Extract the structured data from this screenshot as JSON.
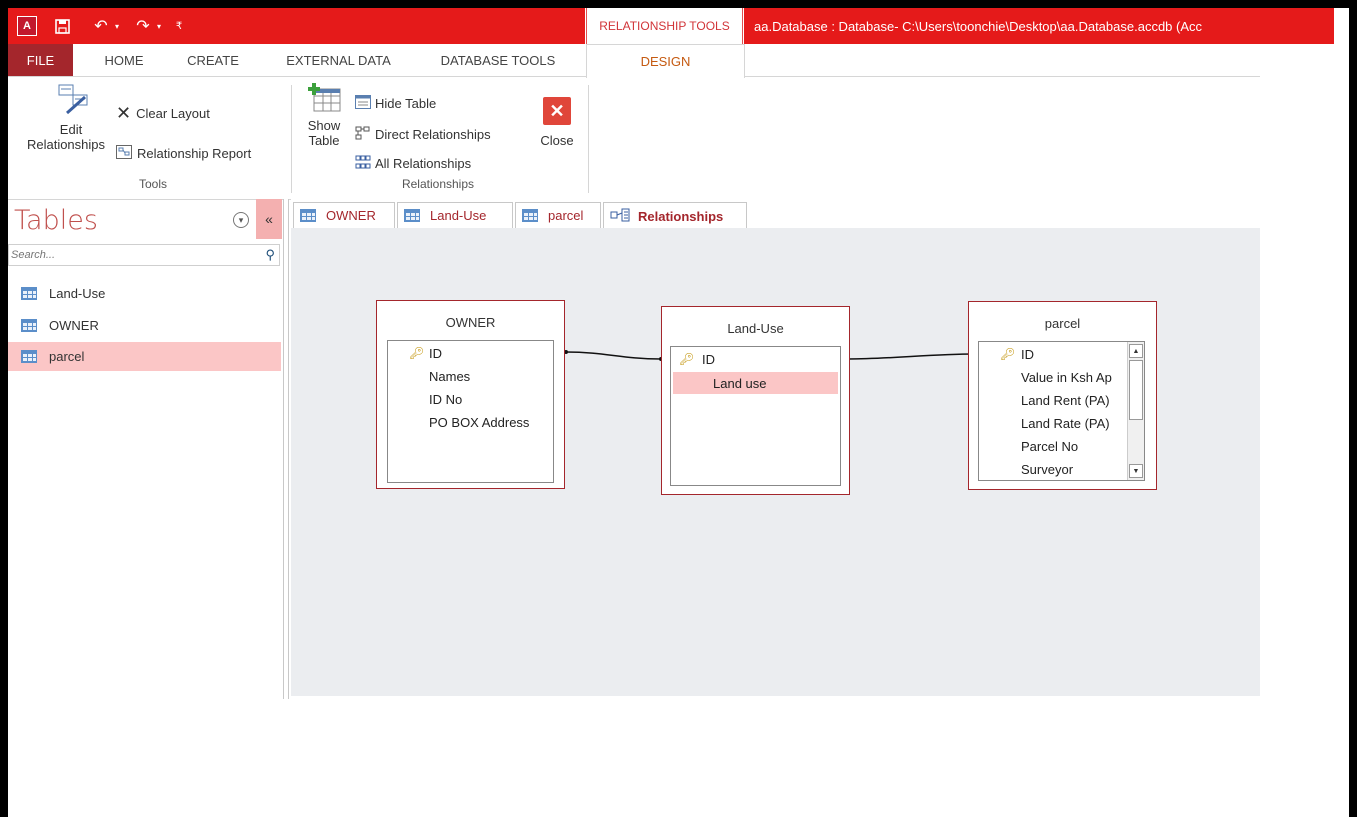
{
  "window": {
    "title": "aa.Database : Database- C:\\Users\\toonchie\\Desktop\\aa.Database.accdb (Acc",
    "context_label": "RELATIONSHIP TOOLS"
  },
  "ribbon_tabs": [
    "FILE",
    "HOME",
    "CREATE",
    "EXTERNAL DATA",
    "DATABASE TOOLS",
    "DESIGN"
  ],
  "ribbon": {
    "tools": {
      "edit_relationships": "Edit Relationships",
      "edit_line1": "Edit",
      "edit_line2": "Relationships",
      "clear_layout": "Clear Layout",
      "relationship_report": "Relationship Report",
      "group_label": "Tools"
    },
    "relationships": {
      "show_line1": "Show",
      "show_line2": "Table",
      "hide_table": "Hide Table",
      "direct_relationships": "Direct Relationships",
      "all_relationships": "All Relationships",
      "close": "Close",
      "group_label": "Relationships"
    }
  },
  "nav": {
    "title": "Tables",
    "search_placeholder": "Search...",
    "items": [
      {
        "label": "Land-Use"
      },
      {
        "label": "OWNER"
      },
      {
        "label": "parcel"
      }
    ]
  },
  "doc_tabs": [
    "OWNER",
    "Land-Use",
    "parcel",
    "Relationships"
  ],
  "tables": {
    "owner": {
      "title": "OWNER",
      "fields": [
        "ID",
        "Names",
        "ID No",
        "PO BOX Address"
      ]
    },
    "landuse": {
      "title": "Land-Use",
      "fields": [
        "ID",
        "Land use"
      ]
    },
    "parcel": {
      "title": "parcel",
      "fields": [
        "ID",
        "Value in Ksh Ap",
        "Land Rent (PA)",
        "Land Rate (PA)",
        "Parcel No",
        "Surveyor"
      ]
    }
  },
  "colors": {
    "accent": "#a4262c",
    "title_bar": "#e51a1a",
    "context": "#d13438"
  },
  "icons": [
    "access-logo-icon",
    "save-icon",
    "undo-icon",
    "redo-icon",
    "customize-icon",
    "edit-relationships-icon",
    "clear-layout-icon",
    "relationship-report-icon",
    "show-table-icon",
    "hide-table-icon",
    "direct-relationships-icon",
    "all-relationships-icon",
    "close-icon",
    "search-icon",
    "table-icon",
    "relationships-icon",
    "key-icon"
  ]
}
